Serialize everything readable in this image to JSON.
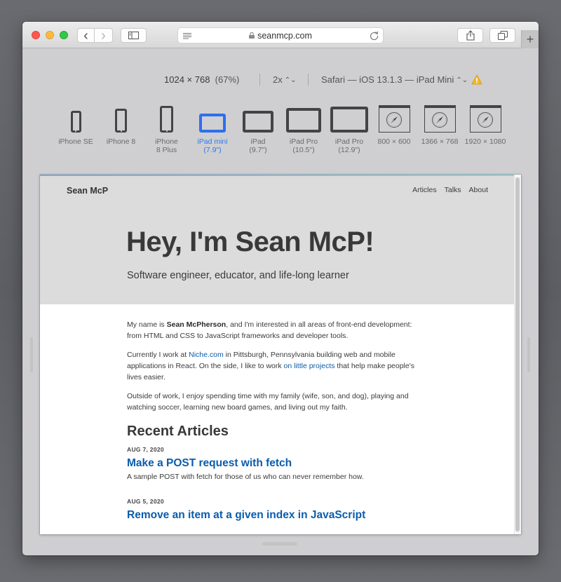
{
  "browser": {
    "address": {
      "url": "seanmcp.com",
      "reader_icon": "reader-view-icon",
      "lock_icon": "lock-icon",
      "reload_icon": "reload-icon"
    },
    "toolbar": {
      "back_glyph": "‹",
      "forward_glyph": "›",
      "new_tab_glyph": "+"
    }
  },
  "responsive_mode": {
    "resolution": "1024 × 768",
    "zoom": "(67%)",
    "pixel_ratio": "2x",
    "user_agent": "Safari — iOS 13.1.3 — iPad Mini",
    "warning_icon": "warning-icon",
    "devices": [
      {
        "label": "iPhone SE",
        "type": "phone"
      },
      {
        "label": "iPhone 8",
        "type": "phone"
      },
      {
        "label": "iPhone 8 Plus",
        "type": "phone"
      },
      {
        "label": "iPad mini (7.9\")",
        "type": "tablet",
        "active": true
      },
      {
        "label": "iPad (9.7\")",
        "type": "tablet"
      },
      {
        "label": "iPad Pro (10.5\")",
        "type": "tablet"
      },
      {
        "label": "iPad Pro (12.9\")",
        "type": "tablet"
      },
      {
        "label": "800 × 600",
        "type": "desktop"
      },
      {
        "label": "1366 × 768",
        "type": "desktop"
      },
      {
        "label": "1920 × 1080",
        "type": "desktop"
      }
    ],
    "accent_color": "#2c78ec"
  },
  "site": {
    "logo": "Sean McP",
    "nav": [
      "Articles",
      "Talks",
      "About"
    ],
    "hero": {
      "title": "Hey, I'm Sean McP!",
      "tagline": "Software engineer, educator, and life-long learner"
    },
    "intro": {
      "p1_before": "My name is ",
      "p1_bold": "Sean McPherson",
      "p1_after": ", and I'm interested in all areas of front-end development: from HTML and CSS to JavaScript frameworks and developer tools.",
      "p2_before": "Currently I work at ",
      "p2_link1": "Niche.com",
      "p2_middle": " in Pittsburgh, Pennsylvania building web and mobile applications in React. On the side, I like to work ",
      "p2_link2": "on little projects",
      "p2_after": " that help make people's lives easier.",
      "p3": "Outside of work, I enjoy spending time with my family (wife, son, and dog), playing and watching soccer, learning new board games, and living out my faith."
    },
    "recent_heading": "Recent Articles",
    "articles": [
      {
        "date": "AUG 7, 2020",
        "title": "Make a POST request with fetch",
        "description": "A sample POST with fetch for those of us who can never remember how."
      },
      {
        "date": "AUG 5, 2020",
        "title": "Remove an item at a given index in JavaScript",
        "description": ""
      }
    ],
    "link_color": "#0b5cad"
  }
}
